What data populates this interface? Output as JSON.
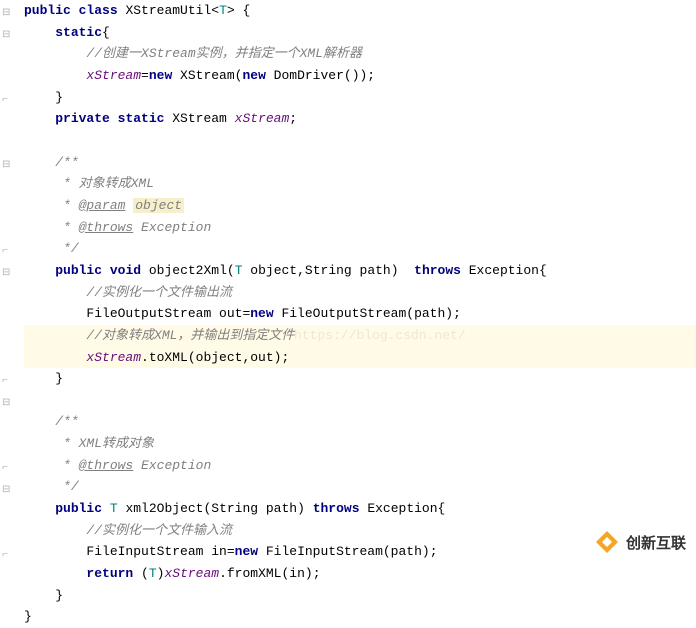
{
  "code": {
    "l1_kw1": "public",
    "l1_kw2": "class",
    "l1_name": " XStreamUtil<",
    "l1_T": "T",
    "l1_end": "> {",
    "l2_kw": "static",
    "l2_brace": "{",
    "l3_comment": "//创建一XStream实例，并指定一个XML解析器",
    "l4_field": "xStream",
    "l4_eq": "=",
    "l4_new1": "new",
    "l4_c1": " XStream(",
    "l4_new2": "new",
    "l4_c2": " DomDriver());",
    "l5": "}",
    "l6_kw1": "private",
    "l6_kw2": "static",
    "l6_type": " XStream ",
    "l6_field": "xStream",
    "l6_semi": ";",
    "l8_c": "/**",
    "l9_c": " * 对象转成XML",
    "l10_star": " * ",
    "l10_tag": "@param",
    "l10_sp": " ",
    "l10_param": "object",
    "l11_star": " * ",
    "l11_tag": "@throws",
    "l11_rest": " Exception",
    "l12_c": " */",
    "l13_kw1": "public",
    "l13_kw2": "void",
    "l13_name": " object2Xml(",
    "l13_T": "T",
    "l13_rest": " object,String path)  ",
    "l13_throws": "throws",
    "l13_exc": " Exception{",
    "l14_c": "//实例化一个文件输出流",
    "l15_a": "FileOutputStream out=",
    "l15_new": "new",
    "l15_b": " FileOutputStream(path);",
    "l16_c": "//对象转成XML，并输出到指定文件",
    "l17_field": "xStream",
    "l17_rest": ".toXML(object,out);",
    "l18": "}",
    "l20_c": "/**",
    "l21_c": " * XML转成对象",
    "l22_star": " * ",
    "l22_tag": "@throws",
    "l22_rest": " Exception",
    "l23_c": " */",
    "l24_kw1": "public",
    "l24_sp1": " ",
    "l24_T": "T",
    "l24_name": " xml2Object(String path) ",
    "l24_throws": "throws",
    "l24_exc": " Exception{",
    "l25_c": "//实例化一个文件输入流",
    "l26_a": "FileInputStream in=",
    "l26_new": "new",
    "l26_b": " FileInputStream(path);",
    "l27_kw": "return",
    "l27_sp": " (",
    "l27_T": "T",
    "l27_paren": ")",
    "l27_field": "xStream",
    "l27_rest": ".fromXML(in);",
    "l28": "}",
    "l29": "}"
  },
  "watermark": "https://blog.csdn.net/",
  "logo_text": "创新互联"
}
